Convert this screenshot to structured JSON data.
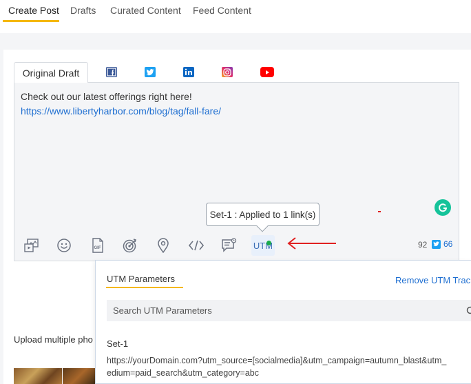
{
  "top_tabs": {
    "create_post": "Create Post",
    "drafts": "Drafts",
    "curated_content": "Curated Content",
    "feed_content": "Feed Content"
  },
  "network_tabs": {
    "original_draft": "Original Draft",
    "icons": [
      "facebook-icon",
      "twitter-icon",
      "linkedin-icon",
      "instagram-icon",
      "youtube-icon"
    ]
  },
  "editor": {
    "text": "Check out our latest offerings right here!",
    "link": "https://www.libertyharbor.com/blog/tag/fall-fare/"
  },
  "toolbar": {
    "icons": [
      "media-icon",
      "emoji-icon",
      "gif-icon",
      "target-icon",
      "location-icon",
      "code-icon",
      "message-icon"
    ],
    "utm_label": "UTM",
    "char_count": "92",
    "twitter_count": "66"
  },
  "tooltip": {
    "text": "Set-1 : Applied to 1 link(s)"
  },
  "upload": {
    "text": "Upload multiple pho"
  },
  "utm_panel": {
    "title": "UTM Parameters",
    "remove_label": "Remove UTM Track",
    "search_placeholder": "Search UTM Parameters",
    "set_name": "Set-1",
    "set_url_line1": "https://yourDomain.com?utm_source=[socialmedia]&utm_campaign=autumn_blast&utm_",
    "set_url_line2": "edium=paid_search&utm_category=abc"
  },
  "colors": {
    "accent_underline": "#f5b800",
    "link": "#1f6fd1",
    "utm_active_dot": "#1aab4b",
    "annotation_arrow": "#e02020"
  }
}
